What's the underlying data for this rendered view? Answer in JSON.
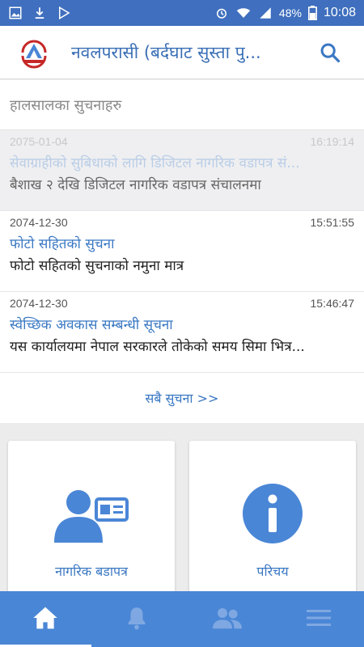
{
  "status_bar": {
    "battery": "48%",
    "time": "10:08",
    "icons": [
      "image-icon",
      "download-icon",
      "play-store-icon",
      "alarm-icon",
      "wifi-icon",
      "signal-icon",
      "battery-icon"
    ]
  },
  "app_bar": {
    "title": "नवलपरासी (बर्दघाट सुस्ता पु...",
    "logo": "nepal-emblem-logo",
    "search_icon": "search-icon"
  },
  "notices": {
    "section_title": "हालसालका सुचनाहरु",
    "items": [
      {
        "date": "2075-01-04",
        "time": "16:19:14",
        "title": "सेवाग्राहीको सुबिधाको लागि डिजिटल नागरिक वडापत्र सं...",
        "body": "बैशाख २ देखि डिजिटल नागरिक वडापत्र संचालनमा"
      },
      {
        "date": "2074-12-30",
        "time": "15:51:55",
        "title": "फोटो सहितको सुचना",
        "body": "फोटो सहितको सुचनाको नमुना मात्र"
      },
      {
        "date": "2074-12-30",
        "time": "15:46:47",
        "title": "स्वेच्छिक अवकास सम्बन्धी सूचना",
        "body": "यस कार्यालयमा नेपाल सरकारले तोकेको समय  सिमा  भित्र..."
      }
    ],
    "all_link": "सबै सुचना >>"
  },
  "cards": [
    {
      "label": "नागरिक बडापत्र",
      "icon": "citizen-id-icon"
    },
    {
      "label": "परिचय",
      "icon": "info-icon"
    }
  ],
  "bottom_nav": [
    {
      "icon": "home-icon",
      "active": true
    },
    {
      "icon": "bell-icon",
      "active": false
    },
    {
      "icon": "people-icon",
      "active": false
    },
    {
      "icon": "menu-icon",
      "active": false
    }
  ],
  "colors": {
    "status_bar": "#3f6fbe",
    "accent": "#3a78c3",
    "bottom_nav": "#4a86d6",
    "icon_blue": "#4a86d6"
  }
}
